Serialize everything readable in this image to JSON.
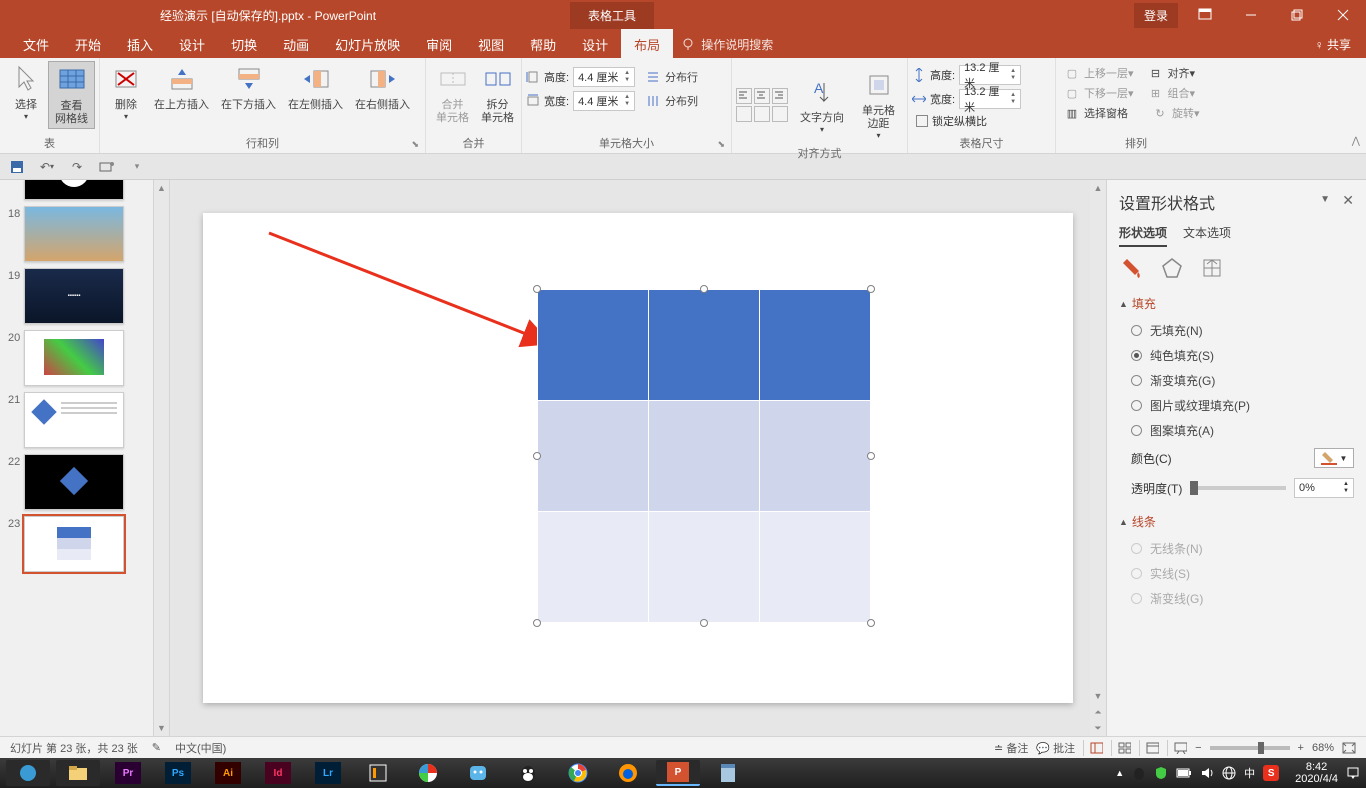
{
  "title": "经验演示 [自动保存的].pptx - PowerPoint",
  "toolbox_tab": "表格工具",
  "login": "登录",
  "share": "共享",
  "help_prompt": "操作说明搜索",
  "menu": {
    "file": "文件",
    "home": "开始",
    "insert": "插入",
    "design": "设计",
    "transitions": "切换",
    "animations": "动画",
    "slideshow": "幻灯片放映",
    "review": "审阅",
    "view": "视图",
    "help": "帮助",
    "tdesign": "设计",
    "layout": "布局"
  },
  "ribbon": {
    "table_group": "表",
    "select": "选择",
    "view_gridlines": "查看\n网格线",
    "rows_cols_group": "行和列",
    "delete": "删除",
    "insert_above": "在上方插入",
    "insert_below": "在下方插入",
    "insert_left": "在左侧插入",
    "insert_right": "在右侧插入",
    "merge_group": "合并",
    "merge": "合并\n单元格",
    "split": "拆分\n单元格",
    "cellsize_group": "单元格大小",
    "height": "高度:",
    "width": "宽度:",
    "height_val": "4.4 厘米",
    "width_val": "4.4 厘米",
    "dist_rows": "分布行",
    "dist_cols": "分布列",
    "align_group": "对齐方式",
    "text_dir": "文字方向",
    "cell_margins": "单元格\n边距",
    "tablesize_group": "表格尺寸",
    "t_height": "高度:",
    "t_width": "宽度:",
    "t_height_val": "13.2 厘米",
    "t_width_val": "13.2 厘米",
    "lock_aspect": "锁定纵横比",
    "arrange_group": "排列",
    "bring_fwd": "上移一层",
    "send_back": "下移一层",
    "sel_pane": "选择窗格",
    "align": "对齐",
    "group": "组合",
    "rotate": "旋转"
  },
  "thumbs": [
    {
      "n": 18
    },
    {
      "n": 19
    },
    {
      "n": 20
    },
    {
      "n": 21
    },
    {
      "n": 22
    },
    {
      "n": 23
    }
  ],
  "format_pane": {
    "title": "设置形状格式",
    "shape_opts": "形状选项",
    "text_opts": "文本选项",
    "fill": "填充",
    "no_fill": "无填充(N)",
    "solid_fill": "纯色填充(S)",
    "gradient_fill": "渐变填充(G)",
    "picture_fill": "图片或纹理填充(P)",
    "pattern_fill": "图案填充(A)",
    "color": "颜色(C)",
    "transparency": "透明度(T)",
    "transparency_val": "0%",
    "line": "线条",
    "no_line": "无线条(N)",
    "solid_line": "实线(S)",
    "gradient_line": "渐变线(G)"
  },
  "status": {
    "slide_info": "幻灯片 第 23 张，共 23 张",
    "lang": "中文(中国)",
    "notes": "备注",
    "comments": "批注",
    "zoom": "68%"
  },
  "taskbar": {
    "time": "8:42",
    "date": "2020/4/4"
  }
}
